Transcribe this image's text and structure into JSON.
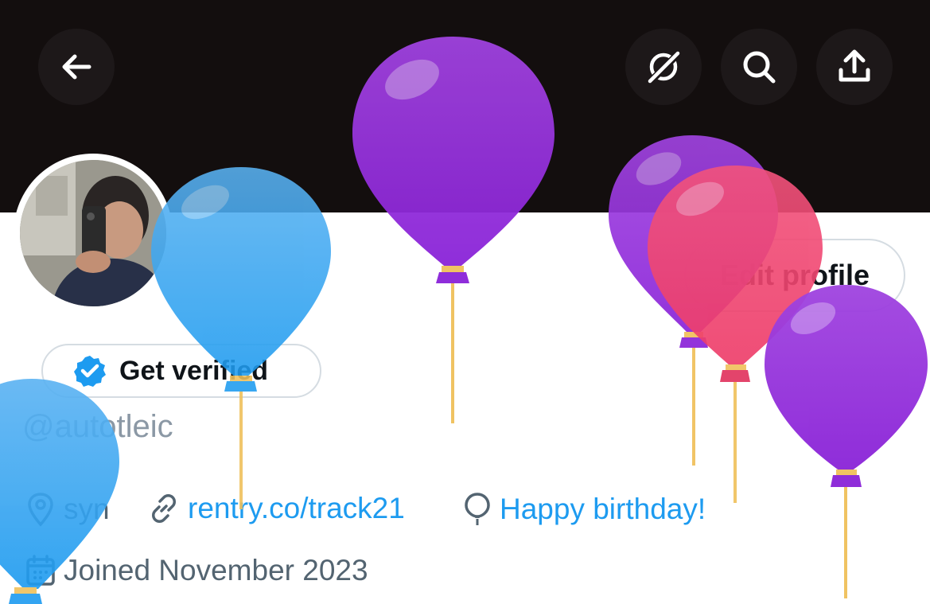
{
  "profile": {
    "handle": "@autotleic",
    "edit_profile_label": "Edit profile",
    "get_verified_label": "Get verified",
    "location": "syn",
    "website": "rentry.co/track21",
    "birthday_text": "Happy birthday!",
    "joined": "Joined November 2023"
  },
  "header": {
    "icons": [
      "back-arrow-icon",
      "grok-icon",
      "search-icon",
      "share-icon"
    ]
  },
  "colors": {
    "banner": "#130e0e",
    "link": "#1d9bf0",
    "muted": "#536471",
    "balloon_blue": "#1d9bf0",
    "balloon_purple": "#9b30e0",
    "balloon_pink": "#f23a6c"
  }
}
